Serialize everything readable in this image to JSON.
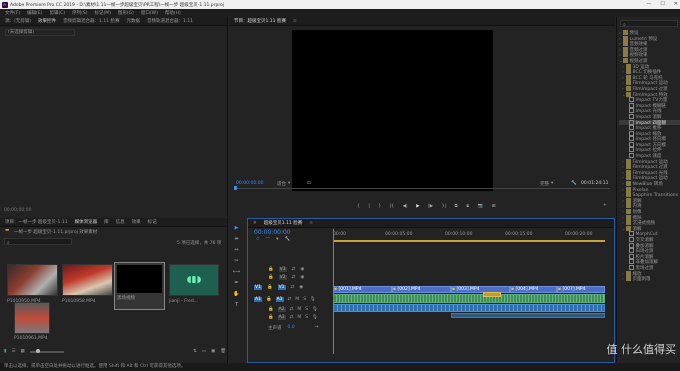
{
  "window": {
    "title": "Adobe Premiere Pro CC 2019 - D:\\素材\\1.11一帧一步超级宝贝\\PR工程\\一帧一步 超级宝贝-1.11.prproj",
    "logo": "Pr",
    "controls": [
      "—",
      "☐",
      "✕"
    ]
  },
  "menu": [
    "文件(F)",
    "编辑(E)",
    "剪辑(C)",
    "序列(S)",
    "标记(M)",
    "图形(G)",
    "窗口(W)",
    "帮助(H)"
  ],
  "source_panel": {
    "tabs": [
      "源：(无剪辑)",
      "效果控件",
      "音频剪辑混合器：1.11 脸赛",
      "元数据",
      "音频轨道混合器：1.11"
    ],
    "empty_label": "(未选择剪辑)",
    "timecode": "00;00;00;00"
  },
  "program_monitor": {
    "tab": "节目：超级宝贝1.11 脸赛",
    "timecode_current": "00:00:00:00",
    "fit_label": "适合",
    "quality_label": "完整",
    "timecode_duration": "00:01:24:11",
    "transport_buttons": [
      "{",
      "|",
      "}",
      "|{",
      "◀|",
      "▶",
      "|▶",
      "}|",
      "⧉",
      "⧈",
      "📷",
      "⊞",
      "+"
    ]
  },
  "project_panel": {
    "tabs": [
      "项目：一帧一步 超级宝贝-1.11",
      "媒体浏览器",
      "库",
      "信息",
      "效果",
      "标记"
    ],
    "active_tab": "媒体浏览器",
    "file_name": "一帧一步 超级宝贝-1.11.prproj 效果素材",
    "selection_info": "5 项已选择，共 76 项",
    "items": [
      {
        "name": "P1010950.MP4",
        "duration": "6:16"
      },
      {
        "name": "P1010958.MP4",
        "duration": "3:20"
      },
      {
        "name": "黑场视频",
        "duration": "5:00"
      },
      {
        "name": "jianji - Fred...",
        "duration": "1:52:30508"
      },
      {
        "name": "P1010961.MP4",
        "duration": "8:03"
      }
    ]
  },
  "timeline": {
    "tab": "超级宝贝1.11 脸赛",
    "timecode": "00:00:00:00",
    "ruler_marks": [
      "00:00",
      "00:00:05:00",
      "00:00:10:00",
      "00:00:15:00",
      "00:00:20:00"
    ],
    "video_tracks": [
      "V3",
      "V2",
      "V1"
    ],
    "audio_tracks": [
      "A1",
      "A2",
      "A3"
    ],
    "master_label": "主声道",
    "master_value": "0.0",
    "clips": [
      "[001].MP4",
      "[002].MP4",
      "[003].MP4",
      "[004].MP4",
      "[007].MP4"
    ]
  },
  "tools": [
    "▶",
    "⇹",
    "↔",
    "◆",
    "✂",
    "⟷",
    "✒",
    "✋",
    "T"
  ],
  "effects_panel": {
    "items": [
      {
        "label": "预设",
        "indent": 1,
        "type": "folder"
      },
      {
        "label": "Lumetri 预设",
        "indent": 1,
        "type": "folder"
      },
      {
        "label": "音频效果",
        "indent": 1,
        "type": "folder"
      },
      {
        "label": "音频过渡",
        "indent": 1,
        "type": "folder"
      },
      {
        "label": "视频效果",
        "indent": 1,
        "type": "folder"
      },
      {
        "label": "视频过渡",
        "indent": 1,
        "type": "folder-open"
      },
      {
        "label": "3D 运动",
        "indent": 2,
        "type": "folder"
      },
      {
        "label": "BCC 切换插件",
        "indent": 2,
        "type": "folder"
      },
      {
        "label": "BCC 轮 马克托",
        "indent": 2,
        "type": "folder"
      },
      {
        "label": "FilmImpact 运动",
        "indent": 2,
        "type": "folder"
      },
      {
        "label": "FilmImpact 过渡",
        "indent": 2,
        "type": "folder"
      },
      {
        "label": "FilmImpact 特效",
        "indent": 2,
        "type": "folder-open"
      },
      {
        "label": "Impact TV力量",
        "indent": 3,
        "type": "item"
      },
      {
        "label": "Impact 模糊链",
        "indent": 3,
        "type": "item"
      },
      {
        "label": "Impact 光线",
        "indent": 3,
        "type": "item"
      },
      {
        "label": "Impact 溶解",
        "indent": 3,
        "type": "item"
      },
      {
        "label": "Impact 四面翻",
        "indent": 3,
        "type": "item",
        "selected": true
      },
      {
        "label": "Impact 推移",
        "indent": 3,
        "type": "item"
      },
      {
        "label": "Impact 缩放",
        "indent": 3,
        "type": "item"
      },
      {
        "label": "Impact 径向擦",
        "indent": 3,
        "type": "item"
      },
      {
        "label": "Impact 方向模",
        "indent": 3,
        "type": "item"
      },
      {
        "label": "Impact 拉伸",
        "indent": 3,
        "type": "item"
      },
      {
        "label": "Impact 速度",
        "indent": 3,
        "type": "item"
      },
      {
        "label": "FilmImpact 运动",
        "indent": 2,
        "type": "folder"
      },
      {
        "label": "FilmImpact 过渡",
        "indent": 2,
        "type": "folder"
      },
      {
        "label": "FilmImpact 光线",
        "indent": 2,
        "type": "folder"
      },
      {
        "label": "FilmImpact 运动",
        "indent": 2,
        "type": "folder"
      },
      {
        "label": "NewBlue 转场",
        "indent": 2,
        "type": "folder"
      },
      {
        "label": "Pixelan",
        "indent": 2,
        "type": "folder"
      },
      {
        "label": "Sapphire Transitions",
        "indent": 2,
        "type": "folder"
      },
      {
        "label": "溶解",
        "indent": 2,
        "type": "folder"
      },
      {
        "label": "内滑",
        "indent": 2,
        "type": "folder"
      },
      {
        "label": "划像",
        "indent": 2,
        "type": "folder"
      },
      {
        "label": "擦除",
        "indent": 2,
        "type": "folder"
      },
      {
        "label": "沉浸式视频",
        "indent": 2,
        "type": "folder"
      },
      {
        "label": "溶解",
        "indent": 2,
        "type": "folder-open"
      },
      {
        "label": "MorphCut",
        "indent": 3,
        "type": "item"
      },
      {
        "label": "交叉溶解",
        "indent": 3,
        "type": "item"
      },
      {
        "label": "叠加溶解",
        "indent": 3,
        "type": "item"
      },
      {
        "label": "白场过渡",
        "indent": 3,
        "type": "item"
      },
      {
        "label": "胶片溶解",
        "indent": 3,
        "type": "item"
      },
      {
        "label": "非叠加溶解",
        "indent": 3,
        "type": "item"
      },
      {
        "label": "黑场过渡",
        "indent": 3,
        "type": "item"
      },
      {
        "label": "缩放",
        "indent": 2,
        "type": "folder"
      },
      {
        "label": "页面剥落",
        "indent": 2,
        "type": "folder"
      }
    ]
  },
  "watermark": "值 什么值得买",
  "statusbar": "单击以选择，或单击空白处并拖动以进行框选。使用 Shift 和 Alt 和 Ctrl 可获得其他选项。"
}
